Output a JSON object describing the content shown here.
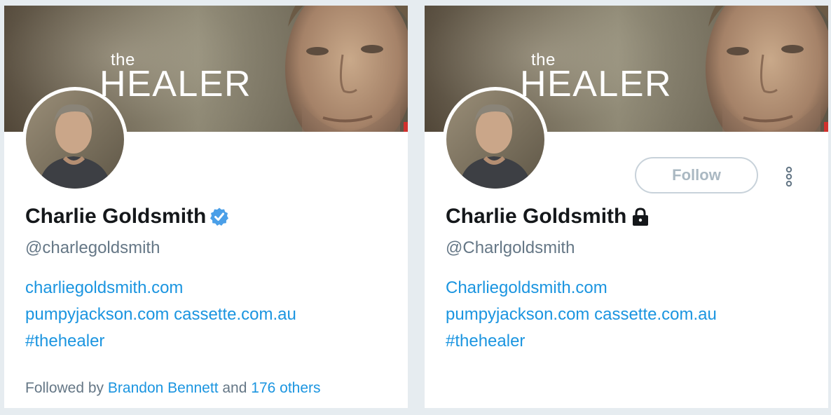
{
  "left_card": {
    "banner": {
      "title_small": "the",
      "title_big": "HEALER"
    },
    "name": "Charlie Goldsmith",
    "handle": "@charlegoldsmith",
    "verified": true,
    "links": [
      "charliegoldsmith.com",
      "pumpyjackson.com",
      "cassette.com.au",
      "#thehealer"
    ],
    "followed_by": {
      "prefix": "Followed by",
      "user": "Brandon Bennett",
      "and": "and",
      "others": "176 others"
    }
  },
  "right_card": {
    "banner": {
      "title_small": "the",
      "title_big": "HEALER"
    },
    "name": "Charlie Goldsmith",
    "handle": "@Charlgoldsmith",
    "protected": true,
    "follow_button": "Follow",
    "links": [
      "Charliegoldsmith.com",
      "pumpyjackson.com",
      "cassette.com.au",
      "#thehealer"
    ]
  },
  "colors": {
    "link": "#1b95e0",
    "verified_badge": "#4a9fe8",
    "secondary_text": "#657786",
    "page_background": "#e6ecf0"
  },
  "icons": [
    "verified-badge-icon",
    "lock-icon",
    "more-options-icon"
  ]
}
